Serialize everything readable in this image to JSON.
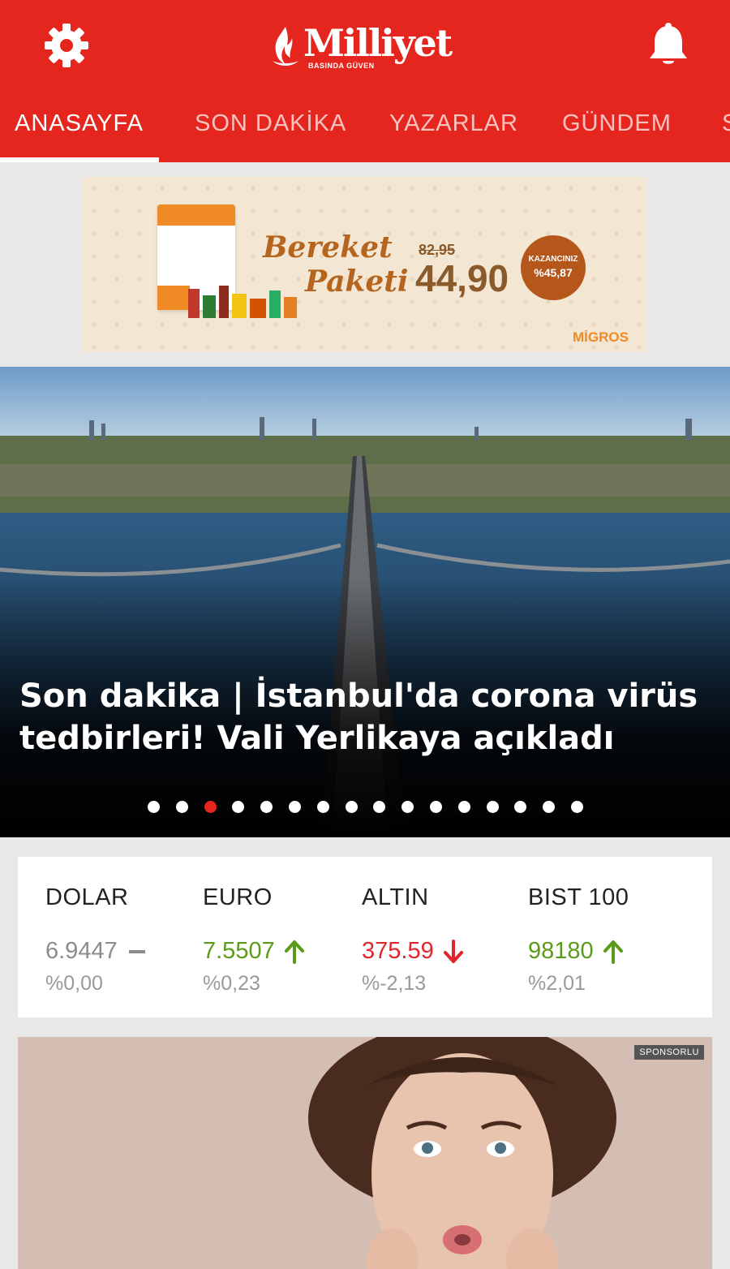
{
  "header": {
    "logo_text": "Milliyet",
    "logo_tagline": "BASINDA GÜVEN",
    "settings_icon": "gear-icon",
    "notifications_icon": "bell-icon",
    "background_color": "#e5261e"
  },
  "tabs": [
    {
      "label": "ANASAYFA",
      "active": true
    },
    {
      "label": "SON DAKİKA",
      "active": false
    },
    {
      "label": "YAZARLAR",
      "active": false
    },
    {
      "label": "GÜNDEM",
      "active": false
    },
    {
      "label": "S",
      "active": false
    }
  ],
  "ad_banner": {
    "title_line1": "Bereket",
    "title_line2": "Paketi",
    "old_price": "82,95",
    "price": "44,90",
    "badge_line1": "KAZANCINIZ",
    "badge_line2": "%45,87",
    "brand": "MİGROS"
  },
  "hero": {
    "headline": "Son dakika | İstanbul'da corona virüs tedbirleri! Vali Yerlikaya açıkladı",
    "slide_count": 16,
    "active_slide": 3
  },
  "market": [
    {
      "name": "DOLAR",
      "value": "6.9447",
      "change": "%0,00",
      "trend": "neutral"
    },
    {
      "name": "EURO",
      "value": "7.5507",
      "change": "%0,23",
      "trend": "up"
    },
    {
      "name": "ALTIN",
      "value": "375.59",
      "change": "%-2,13",
      "trend": "down"
    },
    {
      "name": "BIST 100",
      "value": "98180",
      "change": "%2,01",
      "trend": "up"
    }
  ],
  "sponsored": {
    "badge": "SPONSORLU"
  },
  "colors": {
    "brand_red": "#e5261e",
    "up_green": "#5a9c1a",
    "down_red": "#e0262c",
    "neutral_gray": "#8c8c8c"
  }
}
